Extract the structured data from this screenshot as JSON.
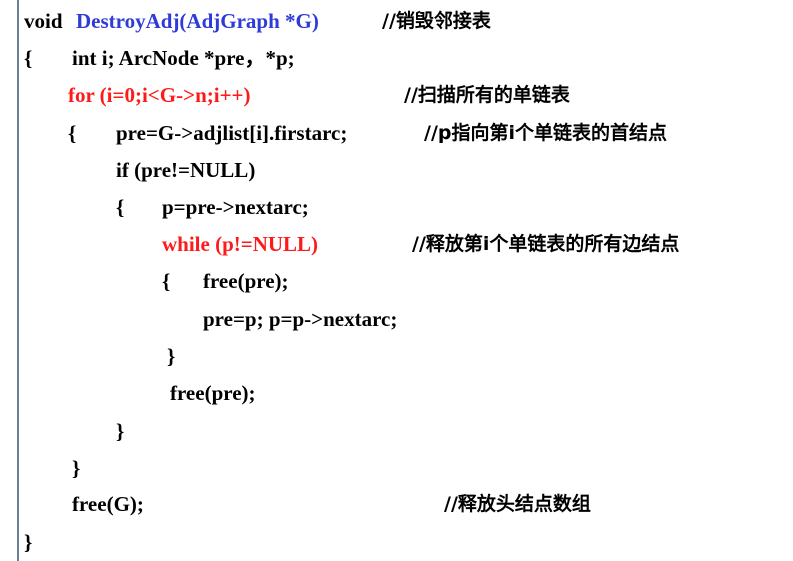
{
  "colors": {
    "keyword_blue": "#2f3bd6",
    "highlight_red": "#ff1a1a",
    "text": "#000000"
  },
  "code": {
    "l1_void": "void",
    "l1_signature": "DestroyAdj(AdjGraph *G)",
    "l1_comment": "//销毁邻接表",
    "l2_brace": "{",
    "l2_decl": "int i; ArcNode *pre，*p;",
    "l3_for": "for (i=0;i<G->n;i++)",
    "l3_comment": "//扫描所有的单链表",
    "l4_brace": "{",
    "l4_stmt": "pre=G->adjlist[i].firstarc;",
    "l4_comment": "//p指向第i个单链表的首结点",
    "l5_if": "if (pre!=NULL)",
    "l6_brace": "{",
    "l6_stmt": "p=pre->nextarc;",
    "l7_while": "while (p!=NULL)",
    "l7_comment": "//释放第i个单链表的所有边结点",
    "l8_brace": "{",
    "l8_stmt": "free(pre);",
    "l9_stmt": "pre=p; p=p->nextarc;",
    "l10_brace": "}",
    "l11_stmt": "free(pre);",
    "l12_brace": "}",
    "l13_brace": "}",
    "l14_stmt": "free(G);",
    "l14_comment": "//释放头结点数组",
    "l15_brace": "}"
  }
}
